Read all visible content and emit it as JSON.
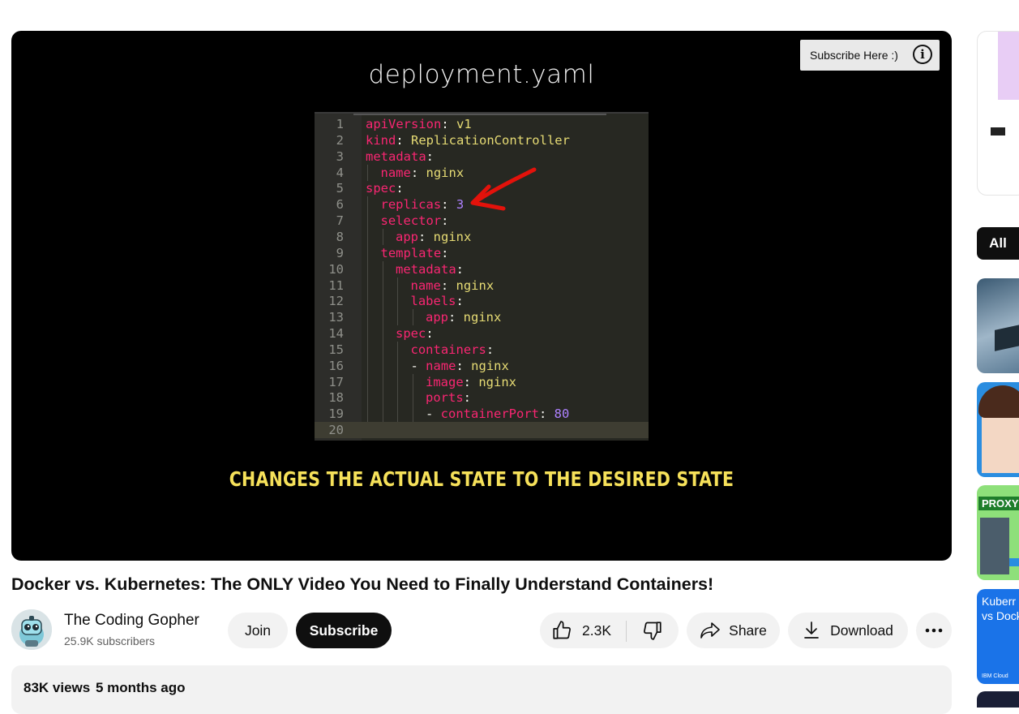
{
  "player": {
    "file_title": "deployment.yaml",
    "caption": "CHANGES THE ACTUAL STATE TO THE DESIRED STATE",
    "subscribe_here_label": "Subscribe Here :)",
    "info_symbol": "i",
    "code_lines": [
      {
        "num": "1",
        "indent": 0,
        "key": "apiVersion",
        "value": "v1",
        "vtype": "s"
      },
      {
        "num": "2",
        "indent": 0,
        "key": "kind",
        "value": "ReplicationController",
        "vtype": "s"
      },
      {
        "num": "3",
        "indent": 0,
        "key": "metadata",
        "value": "",
        "vtype": "s"
      },
      {
        "num": "4",
        "indent": 1,
        "key": "name",
        "value": "nginx",
        "vtype": "s"
      },
      {
        "num": "5",
        "indent": 0,
        "key": "spec",
        "value": "",
        "vtype": "s"
      },
      {
        "num": "6",
        "indent": 1,
        "key": "replicas",
        "value": "3",
        "vtype": "n"
      },
      {
        "num": "7",
        "indent": 1,
        "key": "selector",
        "value": "",
        "vtype": "s"
      },
      {
        "num": "8",
        "indent": 2,
        "key": "app",
        "value": "nginx",
        "vtype": "s"
      },
      {
        "num": "9",
        "indent": 1,
        "key": "template",
        "value": "",
        "vtype": "s"
      },
      {
        "num": "10",
        "indent": 2,
        "key": "metadata",
        "value": "",
        "vtype": "s"
      },
      {
        "num": "11",
        "indent": 3,
        "key": "name",
        "value": "nginx",
        "vtype": "s"
      },
      {
        "num": "12",
        "indent": 3,
        "key": "labels",
        "value": "",
        "vtype": "s"
      },
      {
        "num": "13",
        "indent": 4,
        "key": "app",
        "value": "nginx",
        "vtype": "s"
      },
      {
        "num": "14",
        "indent": 2,
        "key": "spec",
        "value": "",
        "vtype": "s"
      },
      {
        "num": "15",
        "indent": 3,
        "key": "containers",
        "value": "",
        "vtype": "s"
      },
      {
        "num": "16",
        "indent": 3,
        "dash": true,
        "key": "name",
        "value": "nginx",
        "vtype": "s"
      },
      {
        "num": "17",
        "indent": 4,
        "key": "image",
        "value": "nginx",
        "vtype": "s"
      },
      {
        "num": "18",
        "indent": 4,
        "key": "ports",
        "value": "",
        "vtype": "s"
      },
      {
        "num": "19",
        "indent": 4,
        "dash": true,
        "key": "containerPort",
        "value": "80",
        "vtype": "n"
      },
      {
        "num": "20",
        "indent": 0,
        "key": "",
        "value": "",
        "vtype": "s"
      }
    ]
  },
  "video": {
    "title": "Docker vs. Kubernetes: The ONLY Video You Need to Finally Understand Containers!",
    "channel_name": "The Coding Gopher",
    "subscribers": "25.9K subscribers",
    "join_label": "Join",
    "subscribe_label": "Subscribe",
    "like_count": "2.3K",
    "share_label": "Share",
    "download_label": "Download",
    "views": "83K views",
    "age": "5 months ago"
  },
  "sidebar": {
    "chip_all": "All",
    "thumb_labels": [
      "PROXY",
      "Kuberr",
      "vs Dock"
    ]
  },
  "icons": [
    "info-icon",
    "like-icon",
    "dislike-icon",
    "share-icon",
    "download-icon",
    "more-icon",
    "channel-avatar"
  ],
  "colors": {
    "accent_caption": "#f6e15a",
    "code_bg": "#272822",
    "key": "#f92672",
    "string": "#e6db74",
    "number": "#ae81ff",
    "arrow": "#e3120b"
  }
}
